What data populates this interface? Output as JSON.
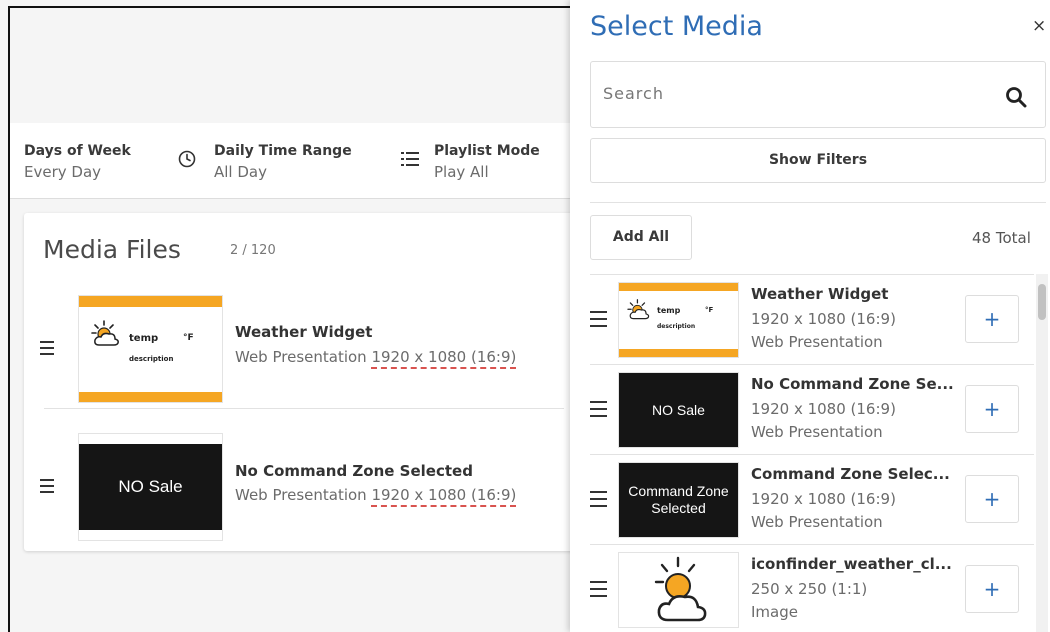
{
  "schedule": {
    "days_label": "Days of Week",
    "days_value": "Every Day",
    "time_label": "Daily Time Range",
    "time_value": "All Day",
    "mode_label": "Playlist Mode",
    "mode_value": "Play All"
  },
  "media_files": {
    "title": "Media Files",
    "count": "2 / 120",
    "items": [
      {
        "name": "Weather Widget",
        "type": "Web Presentation",
        "resolution": "1920 x 1080 (16:9)",
        "thumb": {
          "temp": "temp",
          "unit": "°F",
          "description": "description"
        }
      },
      {
        "name": "No Command Zone Selected",
        "type": "Web Presentation",
        "resolution": "1920 x 1080 (16:9)",
        "thumb": {
          "text": "NO Sale"
        }
      }
    ]
  },
  "panel": {
    "title": "Select Media",
    "close_icon": "×",
    "search_placeholder": "Search",
    "show_filters": "Show Filters",
    "add_all": "Add All",
    "total": "48 Total",
    "add_icon": "+",
    "items": [
      {
        "name": "Weather Widget",
        "resolution": "1920 x 1080 (16:9)",
        "type": "Web Presentation",
        "thumb": {
          "temp": "temp",
          "unit": "°F",
          "description": "description"
        }
      },
      {
        "name": "No Command Zone Se...",
        "resolution": "1920 x 1080 (16:9)",
        "type": "Web Presentation",
        "thumb": {
          "text": "NO Sale"
        }
      },
      {
        "name": "Command Zone Selec...",
        "resolution": "1920 x 1080 (16:9)",
        "type": "Web Presentation",
        "thumb": {
          "line1": "Command Zone",
          "line2": "Selected"
        }
      },
      {
        "name": "iconfinder_weather_cl...",
        "resolution": "250 x 250 (1:1)",
        "type": "Image",
        "thumb": {
          "icon": "sun-cloud-icon"
        }
      }
    ]
  },
  "colors": {
    "accent": "#2f6db5",
    "widget_orange": "#f5a623",
    "error_underline": "#d9534f"
  }
}
